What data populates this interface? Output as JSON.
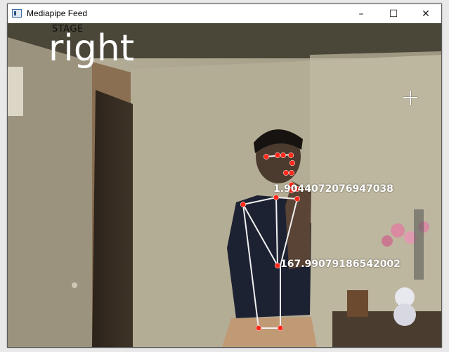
{
  "window": {
    "title": "Mediapipe Feed",
    "minimize_symbol": "–",
    "maximize_symbol": "☐",
    "close_symbol": "✕"
  },
  "overlay": {
    "stage_label": "STAGE",
    "stage_value": "right",
    "angle_upper": "1.9044072076947038",
    "angle_lower": "167.99079186542002"
  },
  "colors": {
    "landmark": "#ff2a1a",
    "connection": "#f0f0f0",
    "overlay_text": "#ffffff"
  },
  "icons": {
    "app": "window-app-icon",
    "cursor": "crosshair-cursor-icon"
  }
}
